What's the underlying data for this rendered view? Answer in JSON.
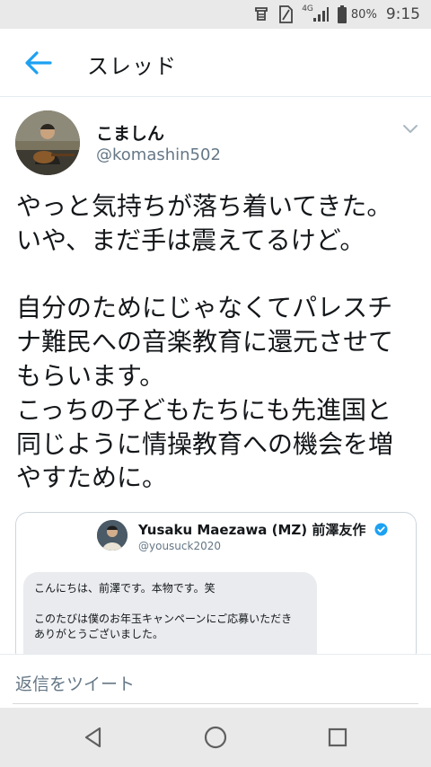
{
  "status_bar": {
    "network": "4G",
    "battery_pct": "80%",
    "time": "9:15"
  },
  "app_bar": {
    "title": "スレッド"
  },
  "tweet": {
    "author_name": "こましん",
    "author_handle": "@komashin502",
    "text_lines": [
      "やっと気持ちが落ち着いてきた。",
      "いや、まだ手は震えてるけど。",
      "",
      "自分のためにじゃなくてパレスチ",
      "ナ難民への音楽教育に還元させて",
      "もらいます。",
      "こっちの子どもたちにも先進国と",
      "同じように情操教育への機会を増",
      "やすために。"
    ]
  },
  "quoted_tweet": {
    "author_name": "Yusaku Maezawa (MZ) 前澤友作",
    "author_handle": "@yousuck2020",
    "verified_color": "#1da1f2",
    "message_lines": [
      "こんにちは、前澤です。本物です。笑",
      "",
      "このたびは僕のお年玉キャンペーンにご応募いただき",
      "ありがとうございました。"
    ]
  },
  "reply_bar": {
    "placeholder": "返信をツイート"
  },
  "colors": {
    "accent": "#1da1f2",
    "secondary_text": "#657786",
    "system_bar": "#e9e9e9"
  }
}
